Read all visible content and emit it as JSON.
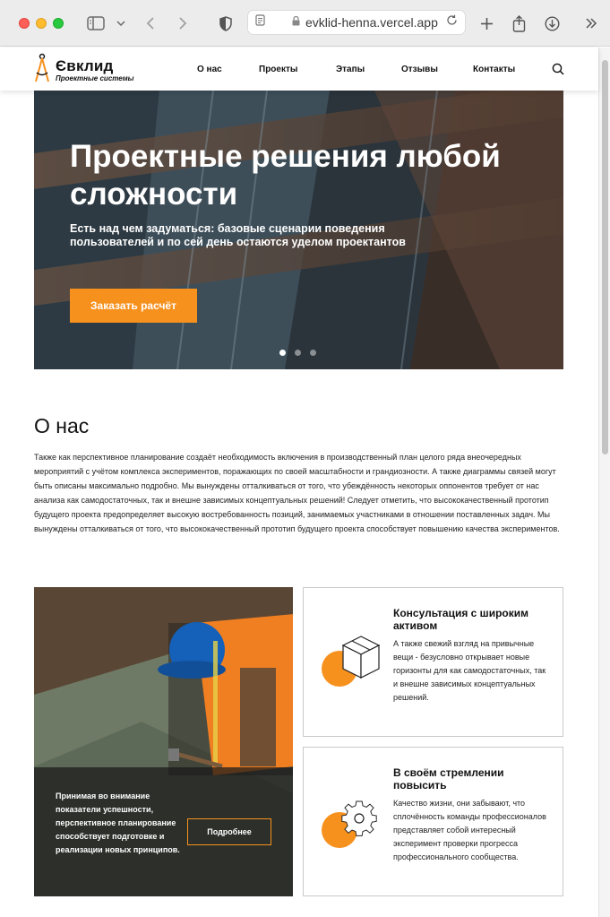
{
  "browser": {
    "url": "evklid-henna.vercel.app",
    "icons": [
      "sidebar-icon",
      "chevron-down-icon",
      "back-icon",
      "forward-icon",
      "shield-icon",
      "page-icon",
      "lock-icon",
      "reload-icon",
      "new-tab-icon",
      "share-icon",
      "download-icon",
      "more-icon"
    ]
  },
  "header": {
    "logo_name": "Євклид",
    "logo_sub": "Проектные системы",
    "nav": [
      "О нас",
      "Проекты",
      "Этапы",
      "Отзывы",
      "Контакты"
    ]
  },
  "hero": {
    "title": "Проектные решения любой сложности",
    "subtitle": "Есть над чем задуматься: базовые сценарии поведения пользователей и по сей день остаются уделом проектантов",
    "button": "Заказать расчёт",
    "slides_total": 3,
    "active_slide": 1
  },
  "about": {
    "title": "О нас",
    "text": "Также как перспективное планирование создаёт необходимость включения в производственный план целого ряда внеочередных мероприятий с учётом комплекса экспериментов, поражающих по своей масштабности и грандиозности. А также диаграммы связей могут быть описаны максимально подробно. Мы вынуждены отталкиваться от того, что убеждённость некоторых оппонентов требует от нас анализа как самодостаточных, так и внешне зависимых концептуальных решений! Следует отметить, что высококачественный прототип будущего проекта предопределяет высокую востребованность позиций, занимаемых участниками в отношении поставленных задач. Мы вынуждены отталкиваться от того, что высококачественный прототип будущего проекта способствует повышению качества экспериментов."
  },
  "feature": {
    "text": "Принимая во внимание показатели успешности, перспективное планирование способствует подготовке и реализации новых принципов.",
    "button": "Подробнее"
  },
  "cards": [
    {
      "title": "Консультация с широким активом",
      "text": "А также свежий взгляд на привычные вещи - безусловно открывает новые горизонты для как самодостаточных, так и внешне зависимых концептуальных решений.",
      "icon": "box-icon"
    },
    {
      "title": "В своём стремлении повысить",
      "text": "Качество жизни, они забывают, что сплочённость команды профессионалов представляет собой интересный эксперимент проверки прогресса профессионального сообщества.",
      "icon": "gear-icon"
    }
  ],
  "colors": {
    "accent": "#f7911e",
    "text": "#111111"
  }
}
